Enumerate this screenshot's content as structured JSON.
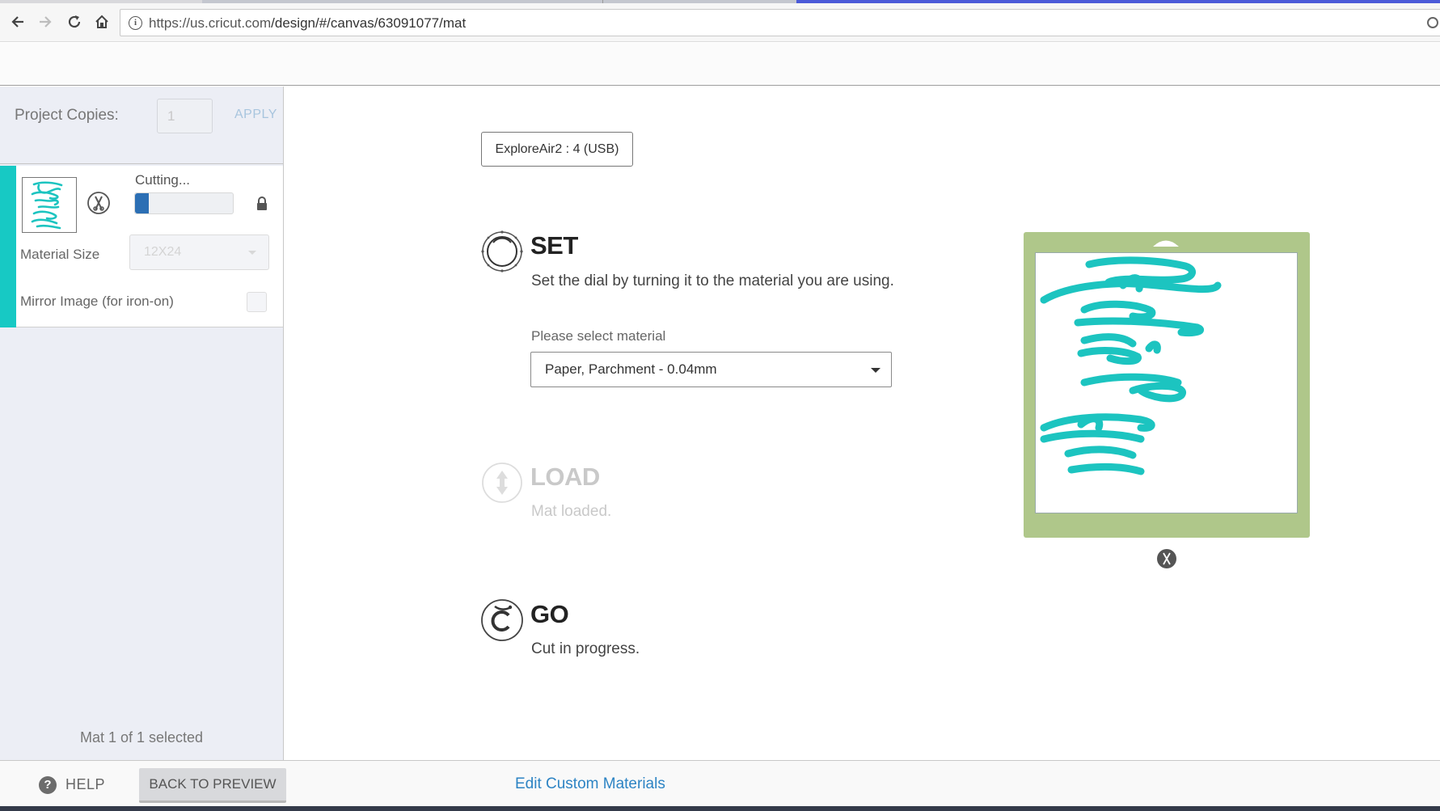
{
  "browser": {
    "url_host": "https://us.cricut.com",
    "url_path": "/design/#/canvas/63091077/mat"
  },
  "left_panel": {
    "project_copies_label": "Project Copies:",
    "project_copies_value": "1",
    "apply_label": "APPLY",
    "mat": {
      "status_label": "Cutting...",
      "progress_fraction": 0.14,
      "material_size_label": "Material Size",
      "material_size_value": "12X24",
      "mirror_label": "Mirror Image (for iron-on)"
    },
    "mat_selection_text": "Mat 1 of 1 selected"
  },
  "main": {
    "device_label": "ExploreAir2 : 4 (USB)",
    "steps": {
      "set": {
        "title": "SET",
        "description": "Set the dial by turning it to the material you are using.",
        "material_prompt": "Please select material",
        "material_value": "Paper, Parchment - 0.04mm"
      },
      "load": {
        "title": "LOAD",
        "description": "Mat loaded."
      },
      "go": {
        "title": "GO",
        "description": "Cut in progress."
      }
    },
    "mat_preview": {
      "mat_color": "#afc78a",
      "design_color": "#1cc4c0"
    }
  },
  "footer": {
    "help_label": "HELP",
    "back_label": "BACK TO PREVIEW",
    "edit_materials_label": "Edit Custom Materials"
  },
  "colors": {
    "accent_teal": "#17c9c4",
    "progress_blue": "#2c6fb4",
    "link_blue": "#2d84c4"
  }
}
